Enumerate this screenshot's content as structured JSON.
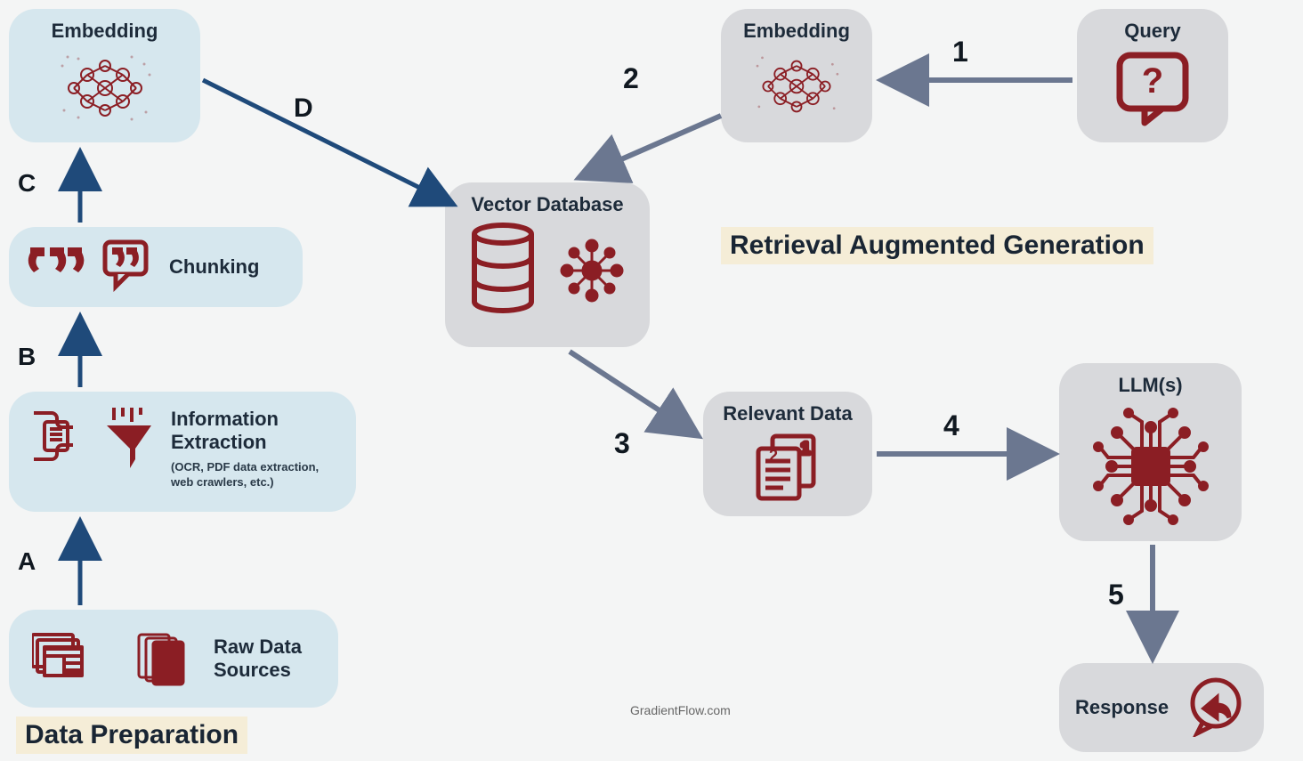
{
  "headings": {
    "data_prep": "Data Preparation",
    "rag": "Retrieval Augmented Generation"
  },
  "watermark": "GradientFlow.com",
  "nodes": {
    "raw_data": "Raw Data Sources",
    "info_extract_title": "Information Extraction",
    "info_extract_sub": "(OCR, PDF data extraction, web crawlers, etc.)",
    "chunking": "Chunking",
    "embedding_left": "Embedding",
    "embedding_right": "Embedding",
    "query": "Query",
    "vector_db": "Vector Database",
    "relevant_data": "Relevant Data",
    "llms": "LLM(s)",
    "response": "Response"
  },
  "steps": {
    "A": "A",
    "B": "B",
    "C": "C",
    "D": "D",
    "s1": "1",
    "s2": "2",
    "s3": "3",
    "s4": "4",
    "s5": "5"
  },
  "colors": {
    "arrow_blue": "#1f4a7a",
    "arrow_grey": "#6b7790",
    "icon_red": "#8b1e24"
  }
}
